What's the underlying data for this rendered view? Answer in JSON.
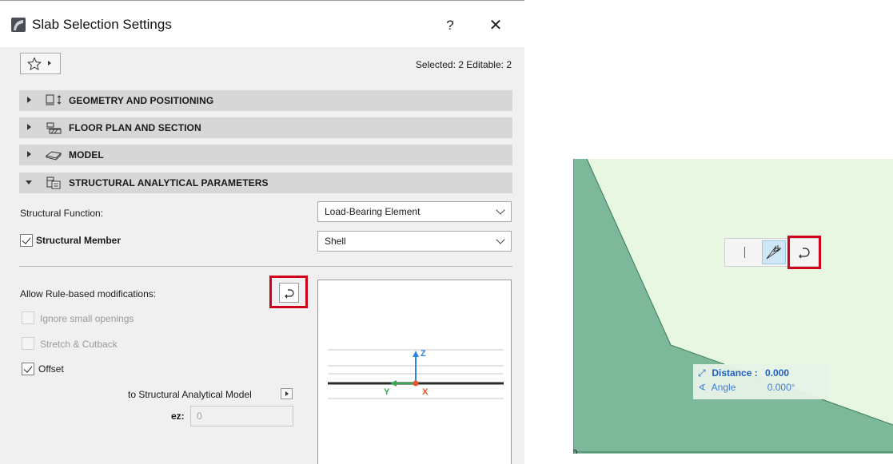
{
  "dialog": {
    "title": "Slab Selection Settings",
    "help_label": "?",
    "close_label": "✕",
    "selection_info": "Selected: 2 Editable: 2",
    "sections": [
      {
        "title": "GEOMETRY AND POSITIONING",
        "icon": "geometry-icon",
        "expanded": false
      },
      {
        "title": "FLOOR PLAN AND SECTION",
        "icon": "floor-plan-icon",
        "expanded": false
      },
      {
        "title": "MODEL",
        "icon": "model-icon",
        "expanded": false
      },
      {
        "title": "STRUCTURAL ANALYTICAL PARAMETERS",
        "icon": "structural-icon",
        "expanded": true
      }
    ],
    "structural_function_label": "Structural Function:",
    "structural_function_value": "Load-Bearing Element",
    "structural_member_label": "Structural Member",
    "structural_member_checked": true,
    "structural_member_value": "Shell",
    "allow_rule_label": "Allow Rule-based modifications:",
    "ignore_openings_label": "Ignore small openings",
    "ignore_openings_checked": false,
    "stretch_label": "Stretch & Cutback",
    "stretch_checked": false,
    "offset_label": "Offset",
    "offset_checked": true,
    "to_model_label": "to Structural Analytical Model",
    "ez_label": "ez:",
    "ez_value": "0",
    "preview_axes": {
      "z": "Z",
      "y": "Y",
      "x": "X"
    }
  },
  "canvas": {
    "tracker": {
      "distance_label": "Distance :",
      "distance_value": "0.000",
      "angle_label": "Angle",
      "angle_value": "0.000°"
    },
    "colors": {
      "background": "#e8f7e2",
      "slab": "#7db89a",
      "highlight": "#d0021b"
    }
  }
}
